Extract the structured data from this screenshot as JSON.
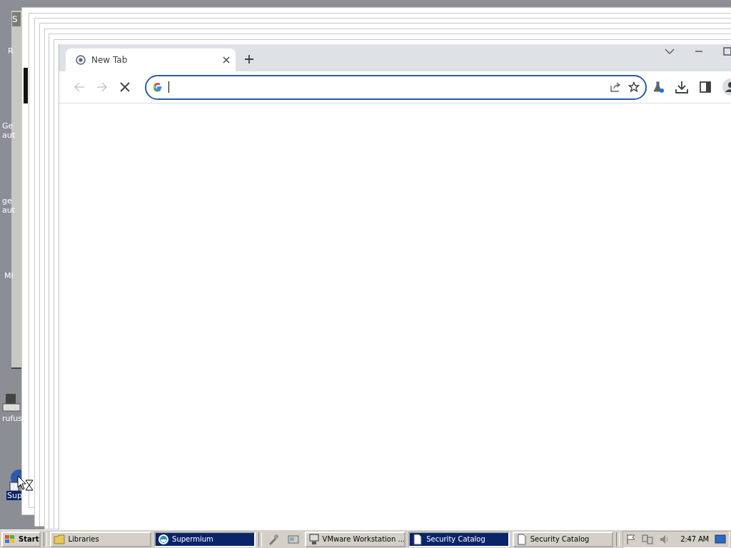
{
  "desktop_icons": [
    {
      "lines": [
        "R"
      ],
      "selected": false
    },
    {
      "lines": [
        "Ge",
        "aut"
      ],
      "selected": false
    },
    {
      "lines": [
        "ge",
        "aut"
      ],
      "selected": false
    },
    {
      "lines": [
        "MI"
      ],
      "selected": false
    },
    {
      "lines": [
        "rufus"
      ],
      "selected": false
    },
    {
      "lines": [
        "Sup"
      ],
      "selected": true
    }
  ],
  "background_window": {
    "title": "S"
  },
  "browser": {
    "tabs": [
      {
        "label": "New Tab",
        "selected": true
      }
    ],
    "back": {
      "disabled": true
    },
    "forward": {
      "disabled": true
    },
    "loading": true
  },
  "taskbar": {
    "start": "Start",
    "buttons": [
      {
        "label": "Libraries",
        "kind": "folder",
        "selected": false
      },
      {
        "label": "Supermium",
        "kind": "browser",
        "selected": true
      },
      {
        "label": "VMware Workstation ...",
        "kind": "vm",
        "selected": false
      },
      {
        "label": "Security Catalog",
        "kind": "doc",
        "selected": true
      },
      {
        "label": "Security Catalog",
        "kind": "doc",
        "selected": false
      }
    ],
    "clock": "2:47 AM"
  }
}
